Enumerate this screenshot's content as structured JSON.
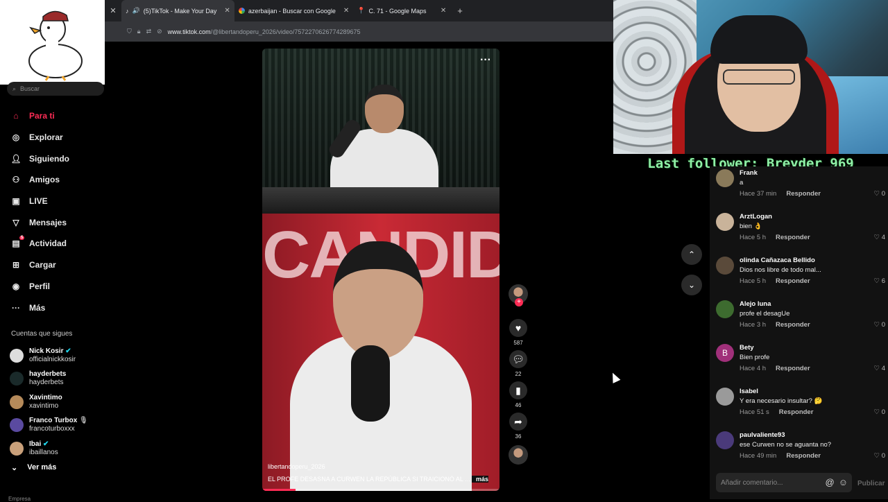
{
  "browser": {
    "tabs": [
      {
        "label": "(5)TikTok - Make Your Day",
        "icon": "tiktok-icon"
      },
      {
        "label": "azerbaijan - Buscar con Google",
        "icon": "google-icon"
      },
      {
        "label": "C. 71 - Google Maps",
        "icon": "maps-icon"
      }
    ],
    "url_host": "www.tiktok.com",
    "url_path": "/@libertandoperu_2026/video/7572270626774289675"
  },
  "stream_overlay": {
    "last_follower": "Last follower: Breyder_969"
  },
  "sidebar": {
    "search_placeholder": "Buscar",
    "nav": [
      {
        "label": "Para ti",
        "icon": "home-icon",
        "active": true
      },
      {
        "label": "Explorar",
        "icon": "compass-icon"
      },
      {
        "label": "Siguiendo",
        "icon": "following-icon"
      },
      {
        "label": "Amigos",
        "icon": "friends-icon"
      },
      {
        "label": "LIVE",
        "icon": "live-icon"
      },
      {
        "label": "Mensajes",
        "icon": "messages-icon"
      },
      {
        "label": "Actividad",
        "icon": "activity-icon",
        "badge": "5"
      },
      {
        "label": "Cargar",
        "icon": "upload-icon"
      },
      {
        "label": "Perfil",
        "icon": "profile-icon"
      },
      {
        "label": "Más",
        "icon": "more-icon"
      }
    ],
    "following_title": "Cuentas que sigues",
    "following": [
      {
        "name": "Nick Kosir",
        "user": "officialnickkosir",
        "verified": true
      },
      {
        "name": "hayderbets",
        "user": "hayderbets"
      },
      {
        "name": "Xavintimo",
        "user": "xavintimo"
      },
      {
        "name": "Franco Turbox",
        "user": "francoturboxxx"
      },
      {
        "name": "Ibai",
        "user": "ibaillanos",
        "verified": true
      }
    ],
    "see_more": "Ver más",
    "footer": "Empresa"
  },
  "video": {
    "username": "libertandoperu_2026",
    "caption": "EL PROFE DESASNA A CURWEN LA REPÚBLICA SI TRAICIONÓ AL ...",
    "more": "más",
    "big_text": "CANDIDA",
    "progress": 0.14
  },
  "actions": {
    "likes": "587",
    "comments": "22",
    "saves": "46",
    "shares": "36"
  },
  "comments": [
    {
      "name": "Frank",
      "text": "a",
      "time": "Hace 37 min",
      "likes": "0",
      "avatar": "#8a7a5a"
    },
    {
      "name": "ArztLogan",
      "text": "bien 👌",
      "time": "Hace 5 h",
      "likes": "4",
      "avatar": "#c9b39a"
    },
    {
      "name": "olinda Cañazaca Bellido",
      "text": "Dios nos libre de todo mal...",
      "time": "Hace 5 h",
      "likes": "6",
      "avatar": "#5a4a3a"
    },
    {
      "name": "Alejo luna",
      "text": "profe el desagUe",
      "time": "Hace 3 h",
      "likes": "0",
      "avatar": "#3d6b2f"
    },
    {
      "name": "Bety",
      "text": "Bien profe",
      "time": "Hace 4 h",
      "likes": "4",
      "avatar": "#a0307a",
      "initial": "B"
    },
    {
      "name": "Isabel",
      "text": "Y era necesario insultar? 🤔",
      "time": "Hace 51 s",
      "likes": "0",
      "avatar": "#9a9a9a"
    },
    {
      "name": "paulvaliente93",
      "text": "ese Curwen no se aguanta no?",
      "time": "Hace 49 min",
      "likes": "0",
      "avatar": "#4a3a7a"
    }
  ],
  "reply_label": "Responder",
  "comment_input": {
    "placeholder": "Añadir comentario...",
    "publish": "Publicar"
  }
}
